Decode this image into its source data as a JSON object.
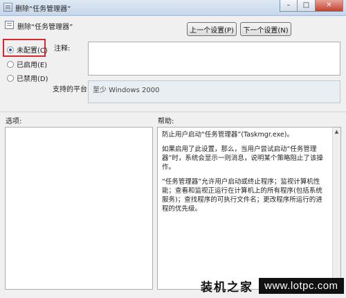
{
  "window": {
    "title": "删除“任务管理器”",
    "minimize_glyph": "–",
    "maximize_glyph": "□",
    "close_glyph": "✕"
  },
  "setting": {
    "name": "删除“任务管理器”",
    "icon": "policy-setting-icon"
  },
  "nav": {
    "prev_label": "上一个设置(P)",
    "next_label": "下一个设置(N)"
  },
  "state": {
    "options": [
      {
        "label": "未配置(C)",
        "selected": true
      },
      {
        "label": "已启用(E)",
        "selected": false
      },
      {
        "label": "已禁用(D)",
        "selected": false
      }
    ],
    "highlight_color": "#d5272f"
  },
  "comment": {
    "label": "注释:",
    "value": ""
  },
  "platform": {
    "label": "支持的平台:",
    "value": "至少 Windows 2000"
  },
  "options_panel": {
    "label": "选项:"
  },
  "help_panel": {
    "label": "帮助:",
    "paragraphs": [
      "防止用户启动“任务管理器”(Taskmgr.exe)。",
      "如果启用了此设置，那么，当用户尝试启动“任务管理器”时，系统会显示一则消息，说明某个策略阻止了该操作。",
      "“任务管理器”允许用户启动或终止程序；监视计算机性能；查看和监视正运行在计算机上的所有程序(包括系统服务)；查找程序的可执行文件名；更改程序所运行的进程的优先级。"
    ]
  },
  "watermark": {
    "site_name": "装机之家",
    "url": "www.lotpc.com"
  }
}
